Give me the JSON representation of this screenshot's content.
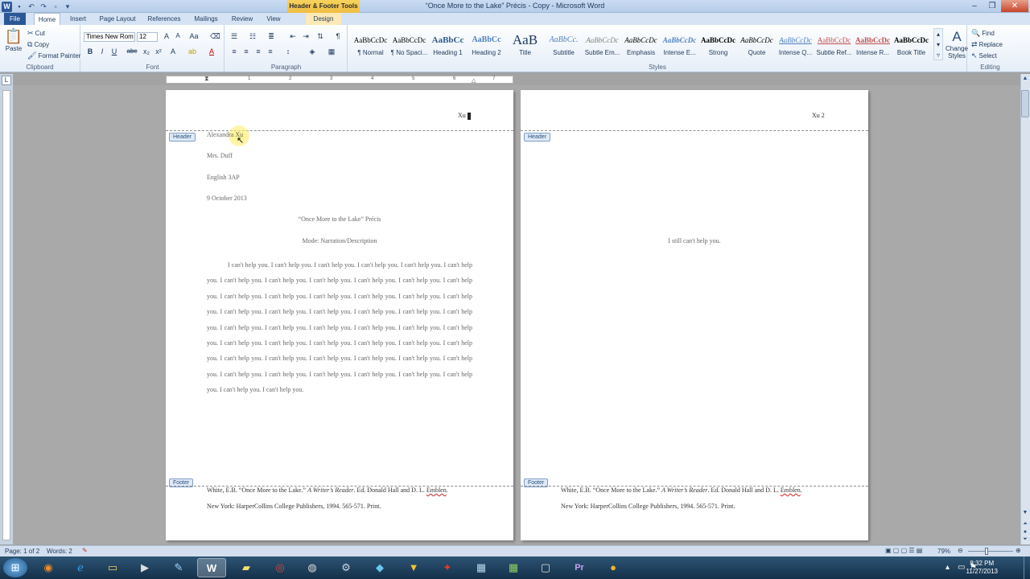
{
  "app": {
    "title": "“Once More to the Lake” Précis - Copy  -  Microsoft Word",
    "context_tools": "Header & Footer Tools",
    "icons": {
      "logo": "word-logo-icon",
      "save": "save-icon",
      "undo": "undo-icon",
      "redo": "redo-icon"
    }
  },
  "tabs": [
    {
      "label": "File"
    },
    {
      "label": "Home"
    },
    {
      "label": "Insert"
    },
    {
      "label": "Page Layout"
    },
    {
      "label": "References"
    },
    {
      "label": "Mailings"
    },
    {
      "label": "Review"
    },
    {
      "label": "View"
    },
    {
      "label": "Design"
    }
  ],
  "ribbon": {
    "clipboard": {
      "group_label": "Clipboard",
      "paste": "Paste",
      "cut": "Cut",
      "copy": "Copy",
      "format_painter": "Format Painter"
    },
    "font": {
      "group_label": "Font",
      "font_name": "Times New Rom",
      "font_size": "12",
      "bold": "B",
      "italic": "I",
      "underline": "U",
      "strike": "abc",
      "subscript": "x₂",
      "superscript": "x²"
    },
    "paragraph": {
      "group_label": "Paragraph"
    },
    "styles": {
      "group_label": "Styles",
      "items": [
        {
          "preview": "AaBbCcDc",
          "name": "¶ Normal"
        },
        {
          "preview": "AaBbCcDc",
          "name": "¶ No Spaci..."
        },
        {
          "preview": "AaBbCc",
          "name": "Heading 1"
        },
        {
          "preview": "AaBbCc",
          "name": "Heading 2"
        },
        {
          "preview": "AaB",
          "name": "Title"
        },
        {
          "preview": "AaBbCc.",
          "name": "Subtitle"
        },
        {
          "preview": "AaBbCcDc",
          "name": "Subtle Em..."
        },
        {
          "preview": "AaBbCcDc",
          "name": "Emphasis"
        },
        {
          "preview": "AaBbCcDc",
          "name": "Intense E..."
        },
        {
          "preview": "AaBbCcDc",
          "name": "Strong"
        },
        {
          "preview": "AaBbCcDc",
          "name": "Quote"
        },
        {
          "preview": "AaBbCcDc",
          "name": "Intense Q..."
        },
        {
          "preview": "AaBbCcDc",
          "name": "Subtle Ref..."
        },
        {
          "preview": "AaBbCcDc",
          "name": "Intense R..."
        },
        {
          "preview": "AaBbCcDc",
          "name": "Book Title"
        }
      ],
      "change_styles": "Change Styles"
    },
    "editing": {
      "group_label": "Editing",
      "find": "Find",
      "replace": "Replace",
      "select": "Select"
    }
  },
  "ruler": {
    "numbers": [
      "1",
      "2",
      "3",
      "4",
      "5",
      "6",
      "7"
    ]
  },
  "page1": {
    "header_text": "Xu",
    "header_tag": "Header",
    "footer_tag": "Footer",
    "name": "Alexandra Xu",
    "teacher": "Mrs. Duff",
    "class": "English 3AP",
    "date": "9 October 2013",
    "title": "“Once More to the Lake” Précis",
    "mode": "Mode: Narration/Description",
    "body": "I can't help you. I can't help you. I can't help you. I can't help you. I can't help you. I can't help you. I can't help you. I can't help you. I can't help you. I can't help you. I can't help you. I can't help you. I can't help you. I can't help you. I can't help you. I can't help you. I can't help you. I can't help you. I can't help you. I can't help you. I can't help you. I can't help you. I can't help you. I can't help you. I can't help you. I can't help you. I can't help you. I can't help you. I can't help you. I can't help you. I can't help you. I can't help you. I can't help you. I can't help you. I can't help you. I can't help you. I can't help you. I can't help you. I can't help you. I can't help you. I can't help you. I can't help you. I can't help you. I can't help you. I can't help you. I can't help you. I can't help you. I can't help you. I can't help you. I can't help you.",
    "footer_line1_a": "White, E.B. “Once More to the Lake.” ",
    "footer_line1_b": "A Writer’s Reader",
    "footer_line1_c": ". Ed. Donald Hall and D. L. ",
    "footer_line1_d": "Emblen",
    "footer_line1_e": ".",
    "footer_line2": "New York: HarperCollins College Publishers, 1994. 565-571. Print."
  },
  "page2": {
    "header_text": "Xu 2",
    "header_tag": "Header",
    "footer_tag": "Footer",
    "body": "I still  can't help you.",
    "footer_line1_a": "White, E.B. “Once More to the Lake.” ",
    "footer_line1_b": "A Writer’s Reader",
    "footer_line1_c": ". Ed. Donald Hall and D. L. ",
    "footer_line1_d": "Emblen",
    "footer_line1_e": ".",
    "footer_line2": "New York: HarperCollins College Publishers, 1994. 565-571. Print."
  },
  "status": {
    "page": "Page: 1 of 2",
    "words": "Words: 2",
    "zoom": "79%"
  },
  "taskbar": {
    "time": "8:32 PM",
    "date": "11/27/2013"
  }
}
